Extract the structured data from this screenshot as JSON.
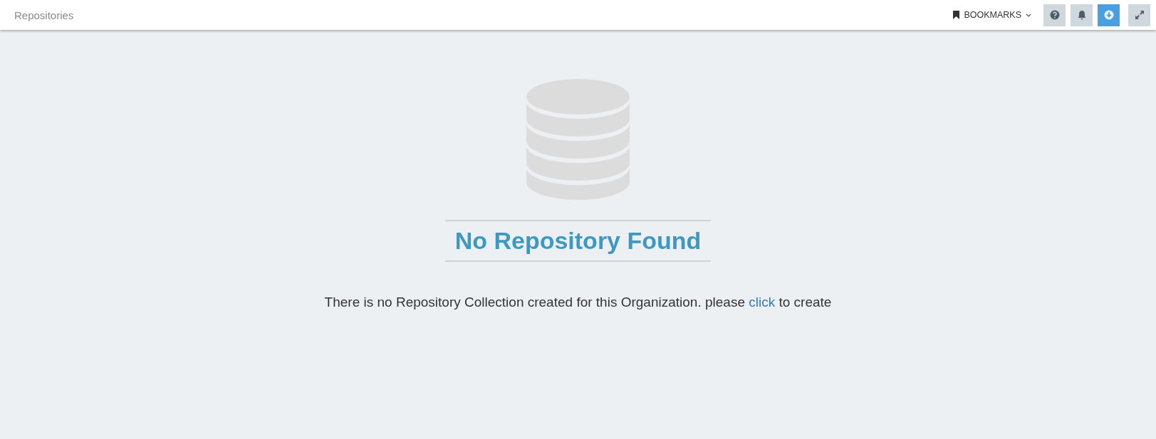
{
  "header": {
    "title": "Repositories",
    "bookmarks": {
      "label": "BOOKMARKS"
    },
    "tools": [
      {
        "kind": "help",
        "active": false
      },
      {
        "kind": "bell",
        "active": false
      },
      {
        "kind": "download",
        "active": true
      },
      {
        "kind": "expand",
        "active": false
      }
    ]
  },
  "empty_state": {
    "heading": "No Repository Found",
    "message": {
      "before": "There is no Repository Collection created for this Organization. please ",
      "link": "click",
      "after": " to create"
    }
  }
}
